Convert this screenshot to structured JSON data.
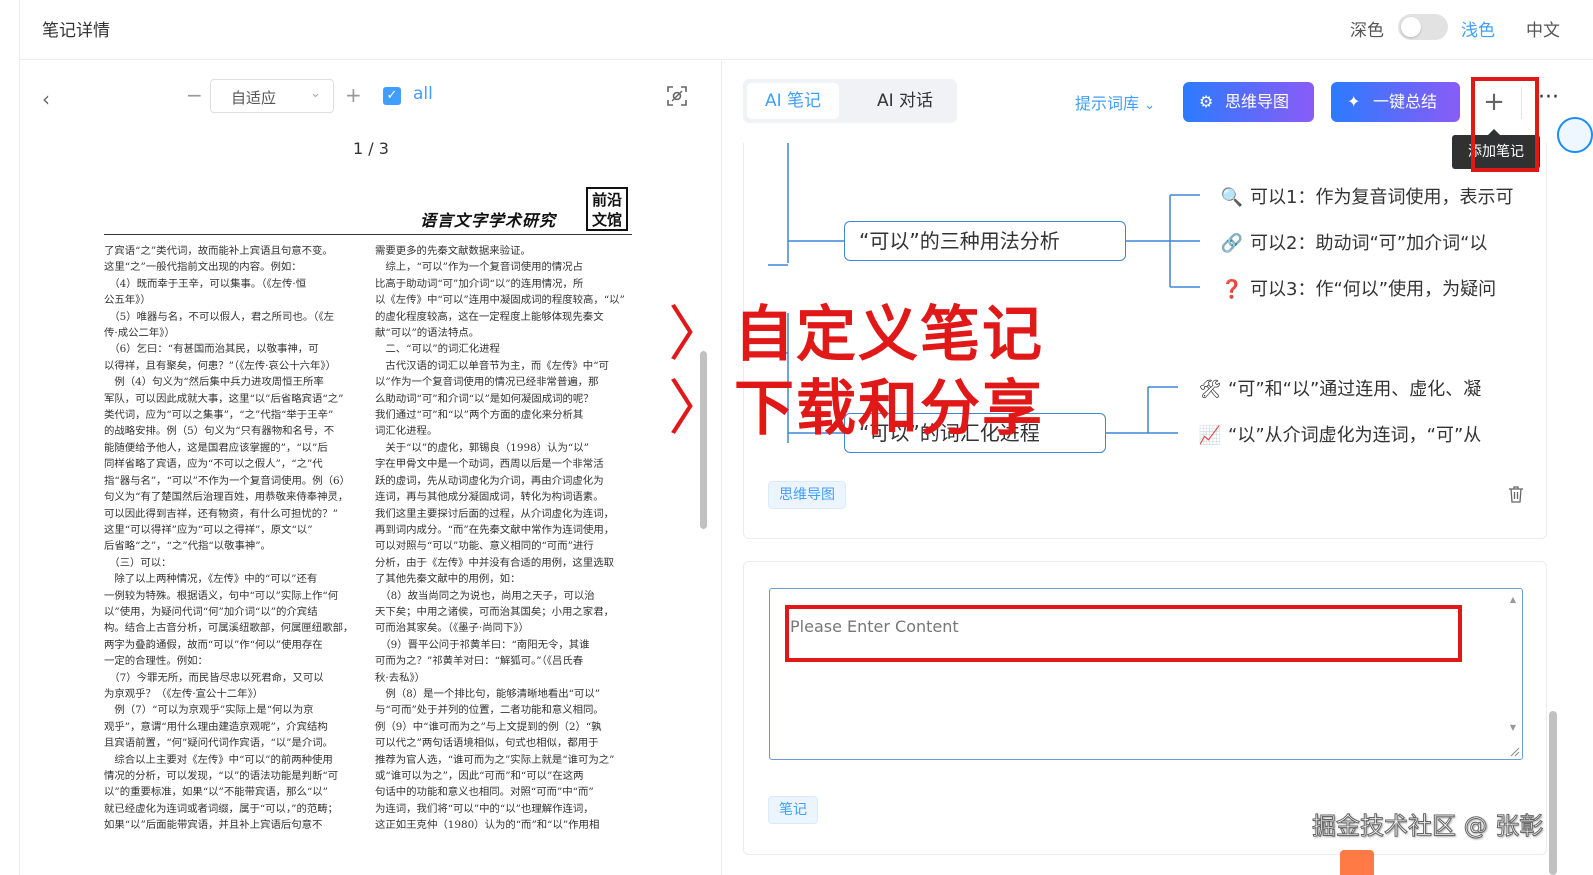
{
  "header": {
    "title": "笔记详情",
    "theme_dark": "深色",
    "theme_light": "浅色",
    "language": "中文"
  },
  "viewer": {
    "zoom_minus": "−",
    "zoom_value": "自适应",
    "zoom_plus": "+",
    "all_label": "all",
    "page_indicator": "1 / 3",
    "journal_title": "语言文字学术研究",
    "seal_text": "前沿 文馆",
    "left_column": [
      "了宾语“之”类代词，故而能补上宾语且句意不变。",
      "这里“之”一般代指前文出现的内容。例如：",
      "　（4）既而幸于王辛，可以集事。（《左传·恒",
      "公五年》）",
      "　（5）唯器与名，不可以假人，君之所司也。（《左",
      "传·成公二年》）",
      "　（6）乞曰：“有甚国而治其民，以敬事神，可",
      "以得祥，且有聚矣，何患？”（《左传·哀公十六年》）",
      "　例（4）句义为“然后集中兵力进攻周恒王所率",
      "军队，可以因此成就大事，这里“以”后省略宾语“之”",
      "类代词，应为“可以之集事”，“之”代指“举于王辛”",
      "的战略安排。例（5）句义为“只有器物和名号，不",
      "能随便给予他人，这是国君应该掌握的”，“以”后",
      "同样省略了宾语，应为“不可以之假人”，“之”代",
      "指“器与名”，“可以”不作为一个复音词使用。例（6）",
      "句义为“有了楚国然后治理百姓，用恭敬来侍奉神灵，",
      "可以因此得到吉祥，还有物资，有什么可担忧的？”",
      "这里“可以得祥”应为“可以之得祥”，原文“以”",
      "后省略“之”，“之”代指“以敬事神”。",
      "　（三）可以：",
      "　除了以上两种情况，《左传》中的“可以”还有",
      "一例较为特殊。根据语义，句中“可以”实际上作“何",
      "以”使用，为疑问代词“何”加介词“以”的介宾结",
      "构。结合上古音分析，可属溪纽歌部，何属匣纽歌部，",
      "两字为叠韵通假，故而“可以”作“何以”使用存在",
      "一定的合理性。例如：",
      "　（7）今罪无所，而民皆尽忠以死君命，又可以",
      "为京观乎？（《左传·宣公十二年》）",
      "　例（7）“可以为京观乎”实际上是“何以为京",
      "观乎”，意谓“用什么理由建造京观呢”，介宾结构",
      "且宾语前置，“何”疑问代词作宾语，“以”是介词。",
      "　综合以上主要对《左传》中“可以”的前两种使用",
      "情况的分析，可以发现，“以”的语法功能是判断“可",
      "以”的重要标准，如果“以”不能带宾语，那么“以”",
      "就已经虚化为连词或者词缀，属于“可以，”的范畴；",
      "如果“以”后面能带宾语，并且补上宾语后句意不"
    ],
    "right_column": [
      "需要更多的先秦文献数据来验证。",
      "　综上，“可以”作为一个复音词使用的情况占",
      "比高于助动词“可”加介词“以”的连用情况，所",
      "以《左传》中“可以”连用中凝固成词的程度较高，“以”",
      "的虚化程度较高，这在一定程度上能够体现先秦文",
      "献“可以”的语法特点。",
      "　二、“可以”的词汇化进程",
      "　古代汉语的词汇以单音节为主，而《左传》中“可",
      "以”作为一个复音词使用的情况已经非常普遍，那",
      "么助动词“可”和介词“以”是如何凝固成词的呢？",
      "我们通过“可”和“以”两个方面的虚化来分析其",
      "词汇化进程。",
      "　关于“以”的虚化，郭锡良（1998）认为“以”",
      "字在甲骨文中是一个动词，西周以后是一个非常活",
      "跃的虚词，先从动词虚化为介词，再由介词虚化为",
      "连词，再与其他成分凝固成词，转化为构词语素。",
      "我们这里主要探讨后面的过程，从介词虚化为连词，",
      "再到词内成分。“而”在先秦文献中常作为连词使用，",
      "可以对照与“可以”功能、意义相同的“可而”进行",
      "分析，由于《左传》中并没有合适的用例，这里选取",
      "了其他先秦文献中的用例，如：",
      "　（8）故当尚同之为说也，尚用之天子，可以治",
      "天下矣；中用之诸侯，可而治其国矣；小用之家君，",
      "可而治其家矣。（《墨子·尚同下》）",
      "　（9）晋平公问于祁黄羊曰：“南阳无令，其谁",
      "可而为之？”祁黄羊对曰：“解狐可。”（《吕氏春",
      "秋·去私》）",
      "　例（8）是一个排比句，能够清晰地看出“可以”",
      "与“可而”处于并列的位置，二者功能和意义相同。",
      "例（9）中“谁可而为之”与上文提到的例（2）“孰",
      "可以代之”两句话语境相似，句式也相似，都用于",
      "推荐为官人选，“谁可而为之”实际上就是“谁可为之”",
      "或“谁可以为之”，因此“可而”和“可以”在这两",
      "句话中的功能和意义也相同。对照“可而”中“而”",
      "为连词，我们将“可以”中的“以”也理解作连词，",
      "这正如王克仲（1980）认为的“而”和“以”作用相"
    ]
  },
  "panel": {
    "tab_ai_note": "AI 笔记",
    "tab_ai_chat": "AI 对话",
    "prompt_library": "提示词库",
    "mindmap_button": "思维导图",
    "summary_button": "一键总结",
    "add_button": "+",
    "more_button": "···",
    "tooltip": "添加笔记"
  },
  "mindmap": {
    "node_1": "“可以”的三种用法分析",
    "node_2": "“可以”的词汇化进程",
    "leaves_1": [
      {
        "icon": "magnifier-icon",
        "glyph": "🔍",
        "text": "可以1：作为复音词使用，表示可"
      },
      {
        "icon": "link-icon",
        "glyph": "🔗",
        "text": "可以2：助动词“可”加介词“以"
      },
      {
        "icon": "question-icon",
        "glyph": "❓",
        "text": "可以3：作“何以”使用，为疑问"
      }
    ],
    "leaves_2": [
      {
        "icon": "tools-icon",
        "glyph": "🛠",
        "text": "“可”和“以”通过连用、虚化、凝"
      },
      {
        "icon": "chart-icon",
        "glyph": "📈",
        "text": "“以”从介词虚化为连词，“可”从"
      }
    ],
    "tag": "思维导图"
  },
  "note": {
    "placeholder": "Please Enter Content",
    "tag": "笔记"
  },
  "annotations": {
    "line_1": "自定义笔记",
    "line_2": "下载和分享",
    "arrow": "〉"
  },
  "watermark": "掘金技术社区 @ 张彰",
  "colors": {
    "primary": "#409eff",
    "annotation_red": "#e01818",
    "mindmap_line": "#3f86d6"
  }
}
